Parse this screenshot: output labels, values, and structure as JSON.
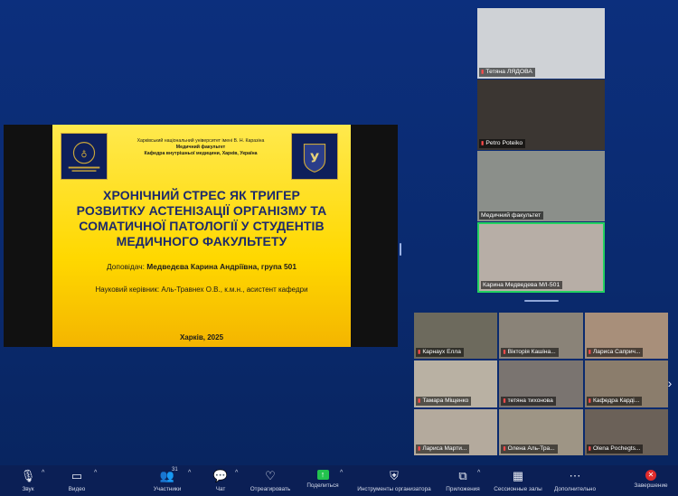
{
  "slide": {
    "university": "Харківський національний університет імені В. Н. Каразіна",
    "faculty": "Медичний факультет",
    "department": "Кафедра внутрішньої медицини, Харків, Україна",
    "title": "ХРОНІЧНИЙ СТРЕС ЯК ТРИГЕР РОЗВИТКУ АСТЕНІЗАЦІЇ ОРГАНІЗМУ ТА СОМАТИЧНОЇ ПАТОЛОГІЇ У СТУДЕНТІВ МЕДИЧНОГО ФАКУЛЬТЕТУ",
    "speaker_label": "Доповідач:",
    "speaker_name": "Медведєва Карина Андріївна, група 501",
    "supervisor": "Науковий керівник: Аль-Травнех О.В., к.м.н., асистент кафедри",
    "city_year": "Харків, 2025"
  },
  "right_tiles": [
    {
      "name": "Тетяна ЛЯДОВА",
      "bg": "#cfd2d6"
    },
    {
      "name": "Petro Poteiko",
      "bg": "#3b3632"
    },
    {
      "name": "Медичний факультет",
      "bg": "#8b8f8a"
    },
    {
      "name": "Карина Медведева М/I-501",
      "bg": "#b7aea6"
    }
  ],
  "gallery": [
    {
      "name": "Карнаух Елла",
      "bg": "#6d6a5d"
    },
    {
      "name": "Вікторія Кашіна...",
      "bg": "#8a8378"
    },
    {
      "name": "Лариса Саприч...",
      "bg": "#a88f7a"
    },
    {
      "name": "Тамара Міщенко",
      "bg": "#b9b1a3"
    },
    {
      "name": "тетяна тихонова",
      "bg": "#7a7470"
    },
    {
      "name": "Кафедра Карді...",
      "bg": "#8b7d6c"
    },
    {
      "name": "Лариса Марти...",
      "bg": "#b4aa9d"
    },
    {
      "name": "Олена Аль-Тра...",
      "bg": "#9e9585"
    },
    {
      "name": "Olena Pochegts...",
      "bg": "#6b6158"
    }
  ],
  "toolbar": {
    "audio": "Звук",
    "video": "Видео",
    "participants": "Участники",
    "participants_count": "31",
    "chat": "Чат",
    "react": "Отреагировать",
    "share": "Поделиться",
    "host_tools": "Инструменты организатора",
    "apps": "Приложения",
    "breakout": "Сессионные залы",
    "more": "Дополнительно",
    "end": "Завершение"
  }
}
